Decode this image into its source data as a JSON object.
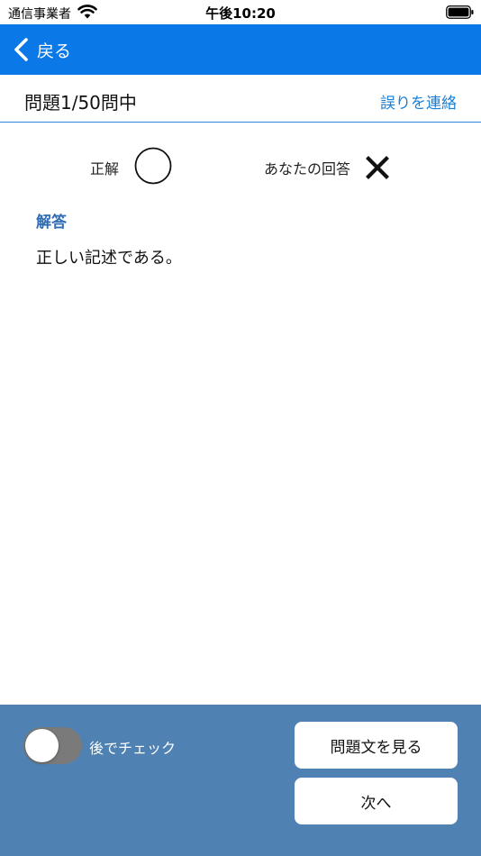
{
  "status_bar": {
    "carrier": "通信事業者",
    "time": "午後10:20",
    "icons": [
      "wifi-icon",
      "battery-icon"
    ]
  },
  "nav": {
    "back_label": "戻る",
    "back_icon": "chevron-left-icon",
    "background": "#0a78e6"
  },
  "header": {
    "counter": "問題1/50問中",
    "report_link": "誤りを連絡"
  },
  "result": {
    "correct_label": "正解",
    "correct_mark": "circle-icon",
    "your_answer_label": "あなたの回答",
    "your_answer_mark": "cross-icon"
  },
  "explanation": {
    "heading": "解答",
    "text": "正しい記述である。"
  },
  "bottom": {
    "later_label": "後でチェック",
    "later_checked": false,
    "view_question_label": "問題文を見る",
    "next_label": "次へ",
    "background": "#4f82b3"
  }
}
